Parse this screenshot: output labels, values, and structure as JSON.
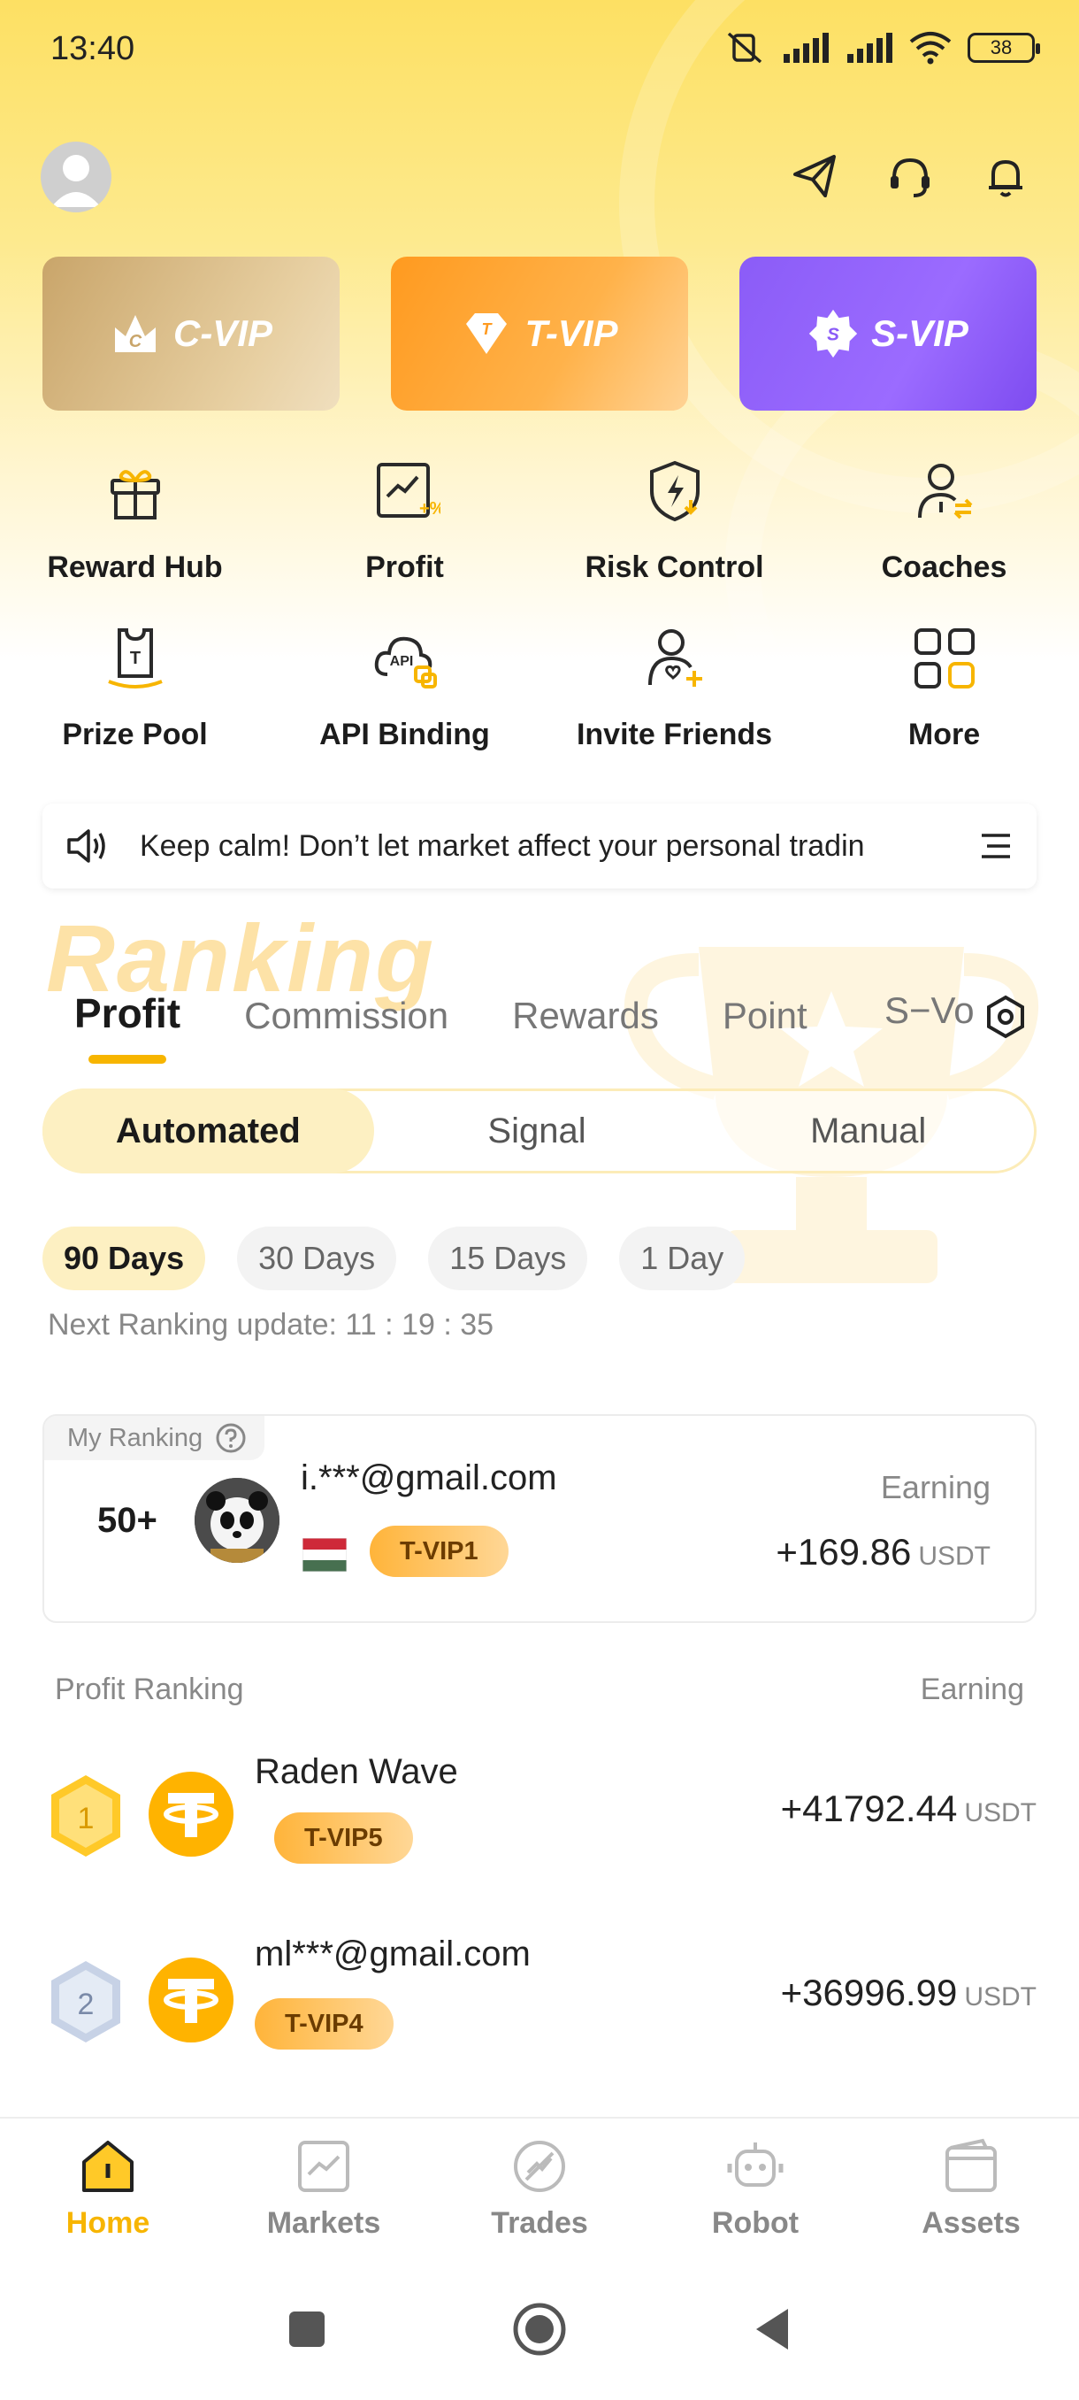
{
  "status_bar": {
    "time": "13:40",
    "battery": "38"
  },
  "vip_cards": [
    {
      "label": "C-VIP",
      "badge_letter": "C"
    },
    {
      "label": "T-VIP",
      "badge_letter": "T"
    },
    {
      "label": "S-VIP",
      "badge_letter": "S"
    }
  ],
  "shortcuts": [
    {
      "label": "Reward Hub",
      "icon": "gift-icon"
    },
    {
      "label": "Profit",
      "icon": "profit-chart-icon"
    },
    {
      "label": "Risk Control",
      "icon": "shield-bolt-icon"
    },
    {
      "label": "Coaches",
      "icon": "coach-icon"
    },
    {
      "label": "Prize Pool",
      "icon": "prize-pool-icon"
    },
    {
      "label": "API Binding",
      "icon": "api-cloud-icon"
    },
    {
      "label": "Invite Friends",
      "icon": "invite-user-icon"
    },
    {
      "label": "More",
      "icon": "grid-more-icon"
    }
  ],
  "notice": {
    "text": "Keep calm! Don’t let market affect your personal tradin"
  },
  "ranking": {
    "title": "Ranking",
    "tabs": [
      "Profit",
      "Commission",
      "Rewards",
      "Point",
      "S−Vo"
    ],
    "modes": [
      "Automated",
      "Signal",
      "Manual"
    ],
    "periods": [
      "90 Days",
      "30 Days",
      "15 Days",
      "1 Day"
    ],
    "update_text": "Next Ranking update: 11 : 19 : 35"
  },
  "my_ranking": {
    "tag": "My Ranking",
    "rank": "50+",
    "name": "i.***@gmail.com",
    "vip": "T-VIP1",
    "earning_label": "Earning",
    "amount": "+169.86",
    "unit": "USDT"
  },
  "profit_ranking": {
    "header_left": "Profit Ranking",
    "header_right": "Earning",
    "rows": [
      {
        "rank": "1",
        "name": "Raden Wave",
        "vip": "T-VIP5",
        "amount": "+41792.44",
        "unit": "USDT"
      },
      {
        "rank": "2",
        "name": "ml***@gmail.com",
        "vip": "T-VIP4",
        "amount": "+36996.99",
        "unit": "USDT"
      }
    ]
  },
  "bottom_nav": [
    {
      "label": "Home",
      "icon": "home-icon"
    },
    {
      "label": "Markets",
      "icon": "markets-icon"
    },
    {
      "label": "Trades",
      "icon": "trades-icon"
    },
    {
      "label": "Robot",
      "icon": "robot-icon"
    },
    {
      "label": "Assets",
      "icon": "wallet-icon"
    }
  ],
  "colors": {
    "accent": "#f7b500",
    "c_vip": "#c9a56a",
    "t_vip": "#ff9a1f",
    "s_vip": "#8b5cf7"
  }
}
